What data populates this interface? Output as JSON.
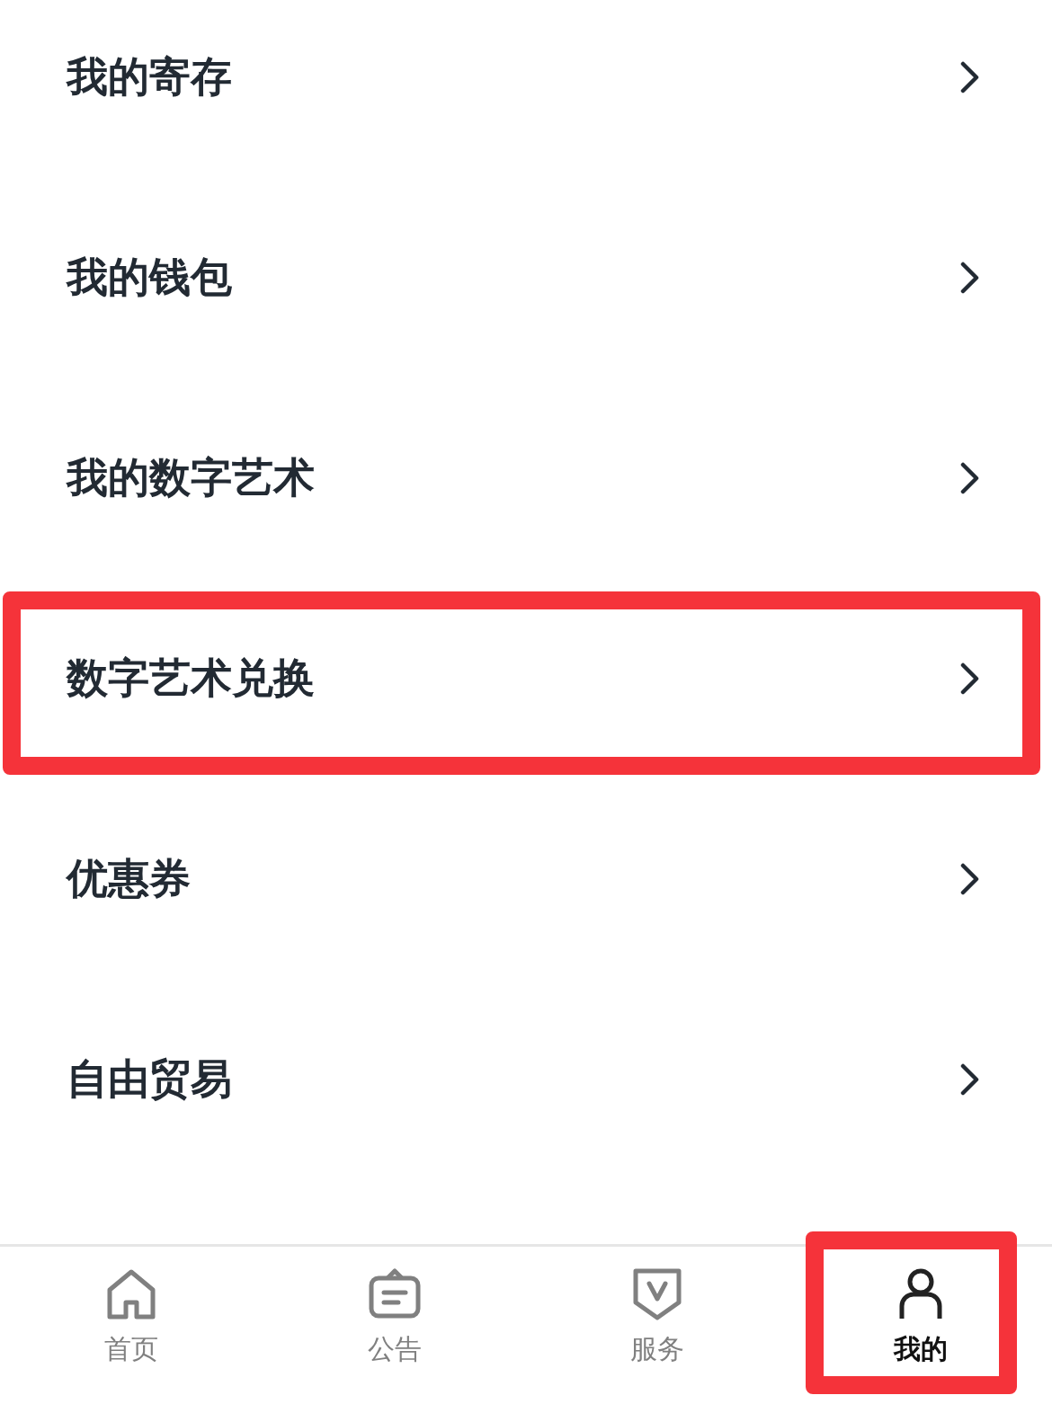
{
  "menu_items": [
    {
      "label": "我的寄存",
      "highlighted": false
    },
    {
      "label": "我的钱包",
      "highlighted": false
    },
    {
      "label": "我的数字艺术",
      "highlighted": false
    },
    {
      "label": "数字艺术兑换",
      "highlighted": true
    },
    {
      "label": "优惠券",
      "highlighted": false
    },
    {
      "label": "自由贸易",
      "highlighted": false
    }
  ],
  "tab_bar": [
    {
      "label": "首页",
      "kind": "home",
      "selected": false,
      "highlighted": false
    },
    {
      "label": "公告",
      "kind": "notice",
      "selected": false,
      "highlighted": false
    },
    {
      "label": "服务",
      "kind": "service",
      "selected": false,
      "highlighted": false
    },
    {
      "label": "我的",
      "kind": "profile",
      "selected": true,
      "highlighted": true
    }
  ]
}
